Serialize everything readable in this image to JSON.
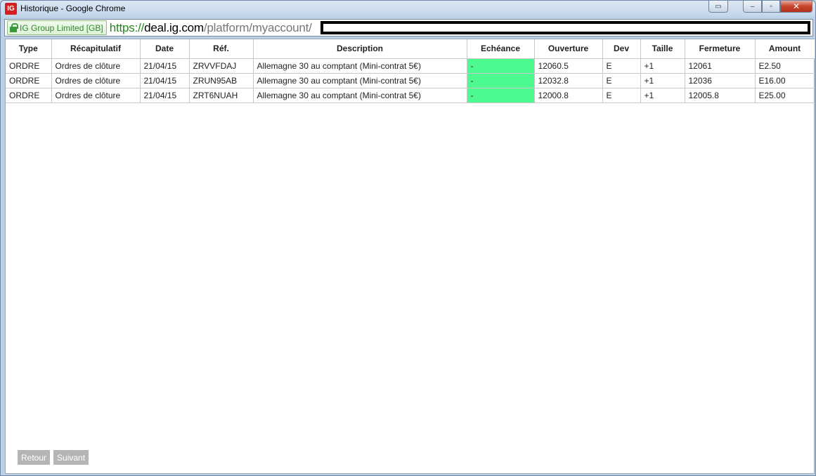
{
  "window": {
    "app_icon": "IG",
    "title": "Historique - Google Chrome"
  },
  "controls": {
    "close_glyph": "✕",
    "restore_glyph": "▫",
    "minimize_glyph": "–"
  },
  "address_bar": {
    "security_label": "IG Group Limited [GB]",
    "url_scheme": "https://",
    "url_host": "deal.ig.com",
    "url_path": "/platform/myaccount/"
  },
  "table": {
    "headers": [
      "Type",
      "Récapitulatif",
      "Date",
      "Réf.",
      "Description",
      "Echéance",
      "Ouverture",
      "Dev",
      "Taille",
      "Fermeture",
      "Amount"
    ],
    "rows": [
      [
        "ORDRE",
        "Ordres de clôture",
        "21/04/15",
        "ZRVVFDAJ",
        "Allemagne 30 au comptant (Mini-contrat 5€)",
        "-",
        "12060.5",
        "E",
        "+1",
        "12061",
        "E2.50"
      ],
      [
        "ORDRE",
        "Ordres de clôture",
        "21/04/15",
        "ZRUN95AB",
        "Allemagne 30 au comptant (Mini-contrat 5€)",
        "-",
        "12032.8",
        "E",
        "+1",
        "12036",
        "E16.00"
      ],
      [
        "ORDRE",
        "Ordres de clôture",
        "21/04/15",
        "ZRT6NUAH",
        "Allemagne 30 au comptant (Mini-contrat 5€)",
        "-",
        "12000.8",
        "E",
        "+1",
        "12005.8",
        "E25.00"
      ]
    ],
    "highlight_column_color": "#4dfa90"
  },
  "pager": {
    "back_label": "Retour",
    "next_label": "Suivant"
  }
}
